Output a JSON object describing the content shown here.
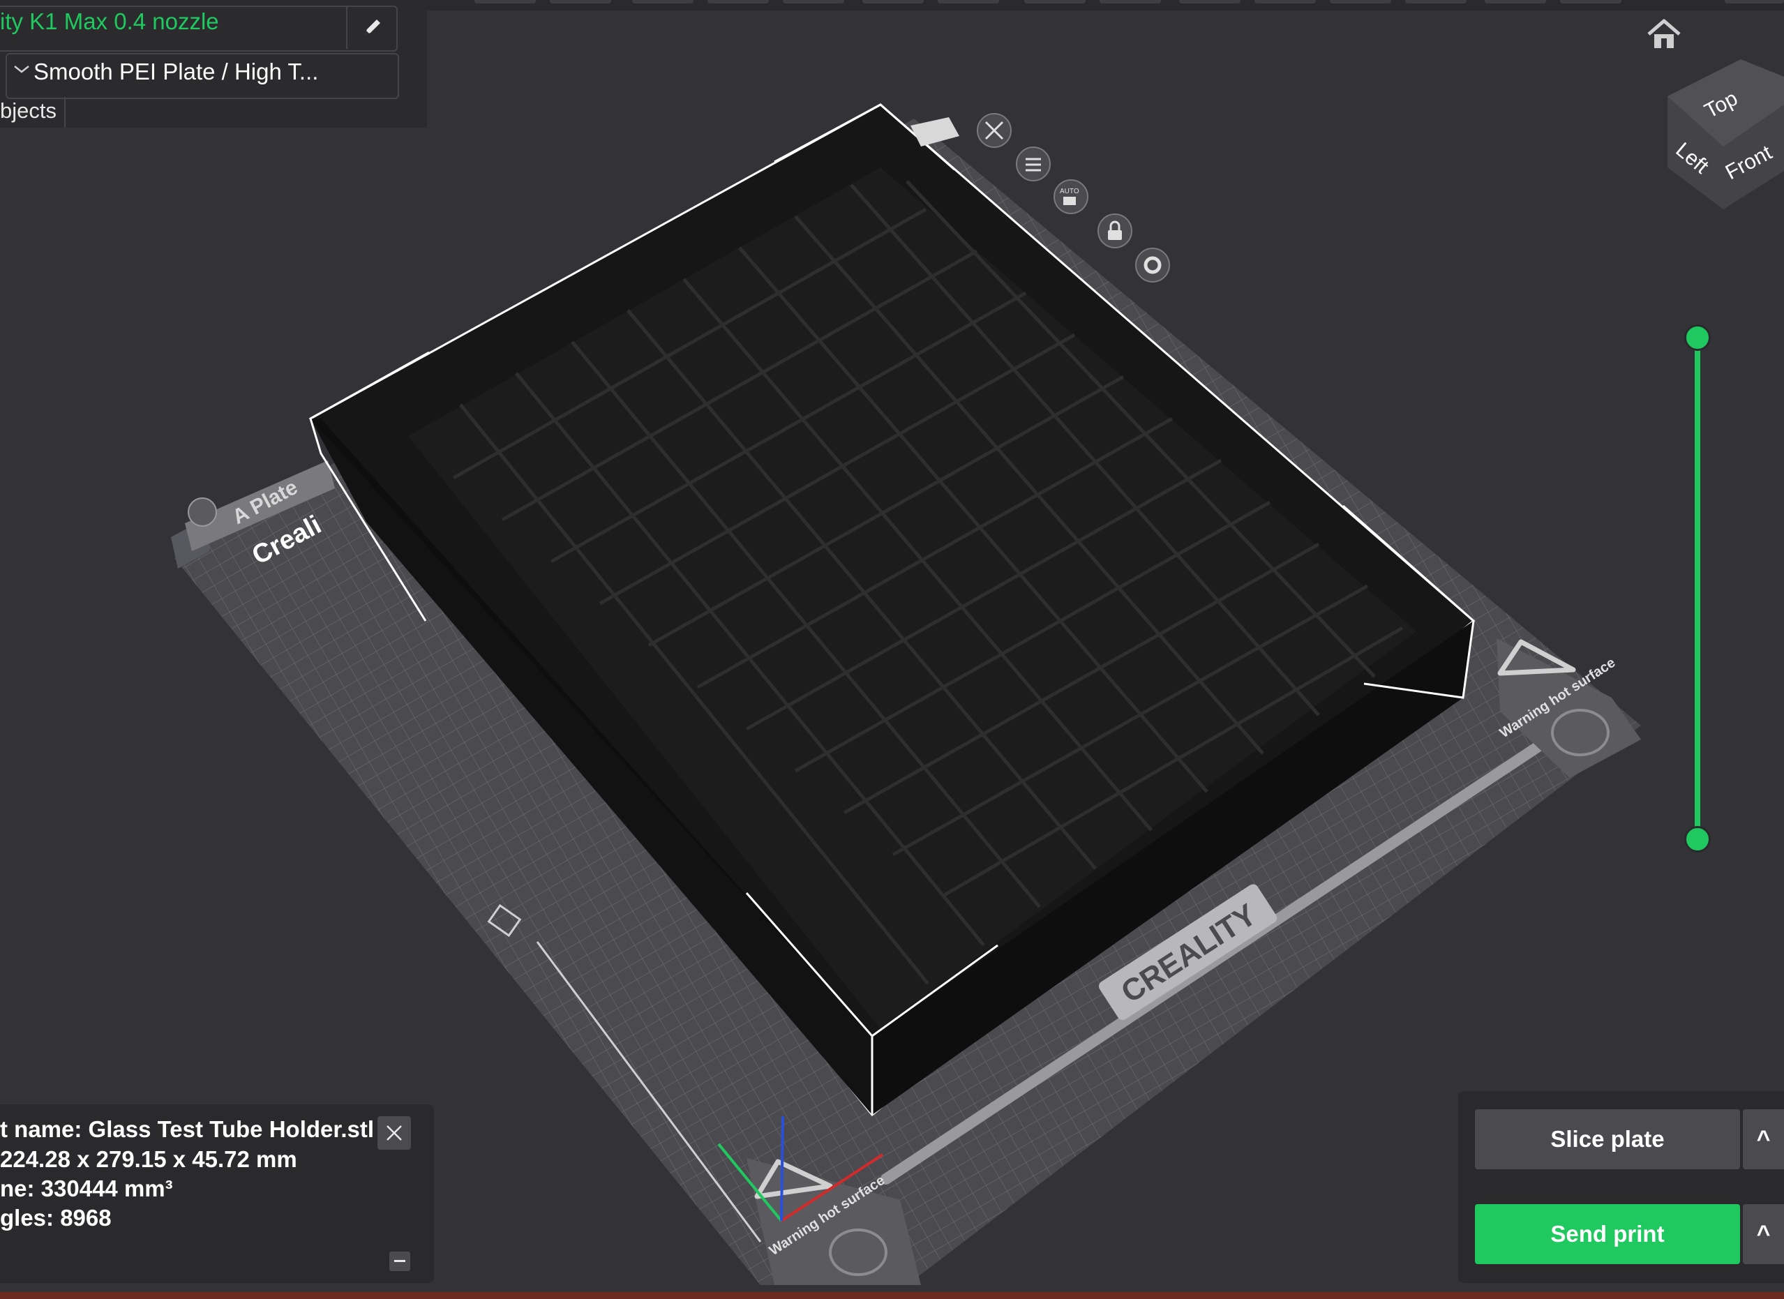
{
  "printer": {
    "name": "ity K1 Max 0.4 nozzle"
  },
  "plate_type": {
    "selected": "Smooth PEI Plate / High T..."
  },
  "tabs": {
    "objects": "bjects"
  },
  "plate": {
    "label": "A Plate",
    "brand_text": "Creali",
    "logo_text": "CREALITY",
    "warning_text": "Warning hot surface",
    "toolbar_auto": "AUTO"
  },
  "view_cube": {
    "top": "Top",
    "left": "Left",
    "front": "Front"
  },
  "object_info": {
    "name_line": "t name: Glass Test Tube Holder.stl",
    "size_line": "224.28 x 279.15 x 45.72 mm",
    "volume_line": "ne: 330444 mm³",
    "triangles_line": "gles: 8968"
  },
  "actions": {
    "slice_label": "Slice plate",
    "send_label": "Send print",
    "caret": "^"
  },
  "colors": {
    "accent": "#1fc960",
    "background": "#333337",
    "panel": "#2b2b2e",
    "button": "#4a4a4f"
  }
}
